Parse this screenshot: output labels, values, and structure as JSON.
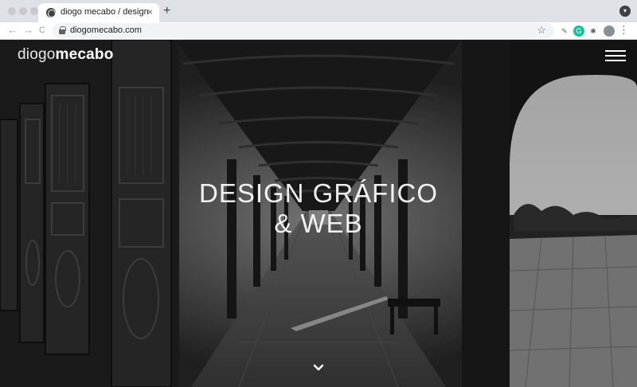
{
  "browser": {
    "tab_title": "diogo mecabo / design",
    "tab_close": "×",
    "new_tab": "+",
    "url": "diogomecabo.com",
    "back": "←",
    "forward": "→",
    "reload": "C",
    "star": "☆",
    "menu": "⋮",
    "extensions": [
      {
        "name": "eyedropper-extension-icon",
        "glyph": "✎",
        "bg": "#ffffff",
        "color": "#5f6368"
      },
      {
        "name": "grammarly-extension-icon",
        "glyph": "G",
        "bg": "#15c39a",
        "color": "#ffffff"
      },
      {
        "name": "puzzle-extension-icon",
        "glyph": "✱",
        "bg": "#ffffff",
        "color": "#5f6368"
      }
    ]
  },
  "site": {
    "logo_light": "diogo",
    "logo_bold": "mecabo",
    "headline_line1": "DESIGN GRÁFICO",
    "headline_line2": "& WEB"
  },
  "colors": {
    "chrome_bg": "#dee1e6",
    "omnibox_bg": "#f1f3f4",
    "hero_text": "#ffffff"
  }
}
